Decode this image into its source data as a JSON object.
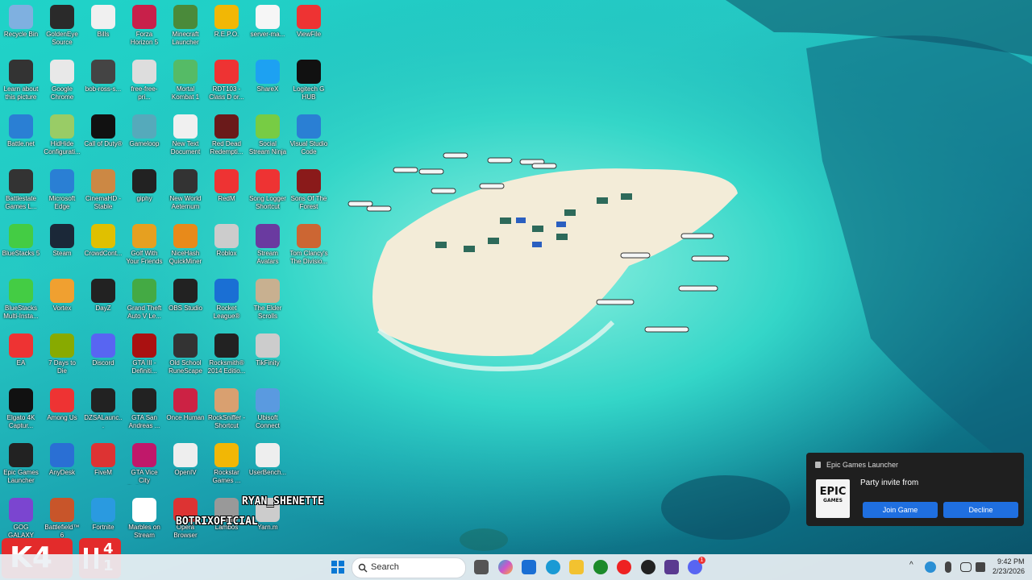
{
  "desktop": {
    "icons": [
      [
        "Recycle Bin",
        "GoldenEye Source",
        "Bills",
        "Forza Horizon 5",
        "Minecraft Launcher",
        "R.E.P.O.",
        "server-ma...",
        "ViewFile"
      ],
      [
        "Learn about this picture",
        "Google Chrome",
        "bob-ross-s...",
        "free-free-pri...",
        "Mortal Kombat 1",
        "RDT103 - Class D or...",
        "ShareX",
        "Logitech G HUB"
      ],
      [
        "Battle.net",
        "HidHide Configurati...",
        "Call of Duty®",
        "Gameloop",
        "New Text Document",
        "Red Dead Redempti...",
        "Social Stream Ninja",
        "Visual Studio Code"
      ],
      [
        "Battlestate Games L...",
        "Microsoft Edge",
        "CinemaHD - Stable",
        "giphy",
        "New World Aeternum",
        "RedM",
        "Song Logger Shortcut",
        "Sons Of The Forest"
      ],
      [
        "BlueStacks 5",
        "Steam",
        "CrowdCont...",
        "Golf With Your Friends",
        "NiceHash QuickMiner",
        "Roblox",
        "Stream Avatars",
        "Tom Clancy's The Divisio..."
      ],
      [
        "BlueStacks Multi-Insta...",
        "Vortex",
        "DayZ",
        "Grand Theft Auto V Le...",
        "OBS Studio",
        "Rocket League®",
        "The Elder Scrolls Online",
        ""
      ],
      [
        "EA",
        "7 Days to Die",
        "Discord",
        "GTA III - Definiti...",
        "Old School RuneScape",
        "Rocksmith® 2014 Editio...",
        "TikFinity",
        ""
      ],
      [
        "Elgato 4K Captur...",
        "Among Us",
        "DZSALaunc...",
        "GTA San Andreas ...",
        "Once Human",
        "RockSniffer - Shortcut",
        "Ubisoft Connect",
        ""
      ],
      [
        "Epic Games Launcher",
        "AnyDesk",
        "FiveM",
        "GTA Vice City Definitive ...",
        "OpenIV",
        "Rockstar Games ...",
        "UserBench...",
        ""
      ],
      [
        "GOG GALAXY",
        "Battlefield™ 6",
        "Fortnite",
        "Marbles on Stream",
        "Opera Browser",
        "Lambos",
        "Yarn.m",
        ""
      ]
    ],
    "icon_colors": [
      [
        "#7fb0e0",
        "#2a2a2a",
        "#f0f0f0",
        "#c8204a",
        "#4a8a3a",
        "#f2b705",
        "#f6f6f6",
        "#e33"
      ],
      [
        "#333",
        "#e8e8e8",
        "#444",
        "#ddd",
        "#5b6",
        "#e33",
        "#1da1f2",
        "#111"
      ],
      [
        "#2a7fd4",
        "#9c6",
        "#111",
        "#5ab",
        "#f0f0f0",
        "#6a1a1a",
        "#7c4",
        "#2a7fd4"
      ],
      [
        "#333",
        "#2a7fd4",
        "#c84",
        "#222",
        "#333",
        "#e33",
        "#e33",
        "#8a1a1a"
      ],
      [
        "#4c4",
        "#1b2838",
        "#e0c000",
        "#e6a020",
        "#e88a1a",
        "#ccc",
        "#6a3aa0",
        "#c63"
      ],
      [
        "#4c4",
        "#f0a030",
        "#222",
        "#4a4",
        "#222",
        "#1a6fd4",
        "#c8b090",
        ""
      ],
      [
        "#e33",
        "#8a0",
        "#5865f2",
        "#a11",
        "#333",
        "#222",
        "#ccc",
        ""
      ],
      [
        "#111",
        "#e33",
        "#222",
        "#222",
        "#c24",
        "#d9a070",
        "#5a9ae0",
        ""
      ],
      [
        "#222",
        "#2a6fd4",
        "#d33",
        "#c0186a",
        "#eee",
        "#f2b705",
        "#eee",
        ""
      ],
      [
        "#7b45d0",
        "#c8552a",
        "#2a9ae0",
        "#fff",
        "#d33",
        "#999",
        "#ccc",
        ""
      ]
    ]
  },
  "notification": {
    "app_name": "Epic Games Launcher",
    "message": "Party invite from",
    "join_label": "Join Game",
    "decline_label": "Decline",
    "logo_text_top": "EPIC",
    "logo_text_bottom": "GAMES"
  },
  "taskbar": {
    "search_placeholder": "Search",
    "time": "9:42 PM",
    "date": "2/23/2026",
    "discord_badge": "1"
  },
  "stream_overlay": {
    "name_1": "RYAN_SHENETTE",
    "name_2": "BOTRIXOFICIAL"
  },
  "brand_tiles": {
    "k4_label": "K4",
    "score_top": "4",
    "score_bottom": "1"
  }
}
